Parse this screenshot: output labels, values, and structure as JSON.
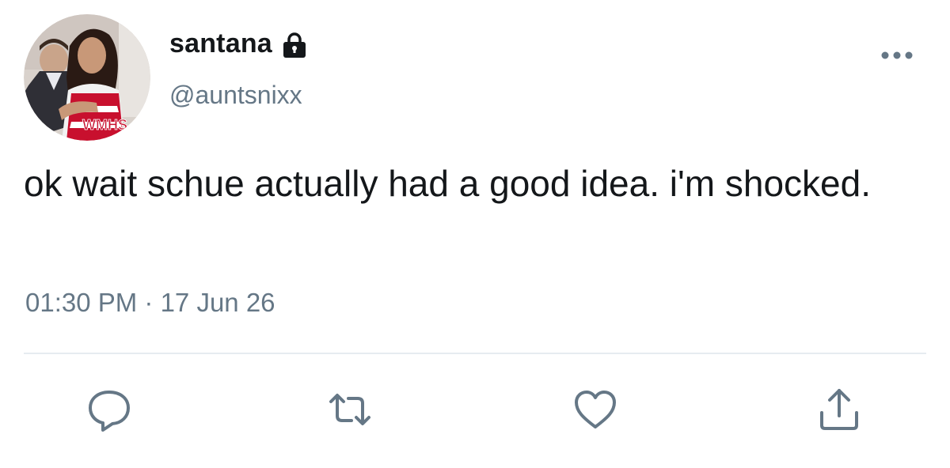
{
  "tweet": {
    "display_name": "santana",
    "handle": "@auntsnixx",
    "text": "ok wait schue actually had a good idea. i'm shocked.",
    "timestamp": "01:30 PM · 17 Jun 26",
    "avatar_text": "WMHS"
  },
  "icons": {
    "lock": "lock-icon",
    "more": "more-icon",
    "reply": "reply-icon",
    "retweet": "retweet-icon",
    "like": "heart-icon",
    "share": "share-icon"
  },
  "colors": {
    "text": "#14171a",
    "secondary": "#657786",
    "divider": "#e6ecf0",
    "icon": "#657786",
    "cheer_red": "#c8102e"
  }
}
